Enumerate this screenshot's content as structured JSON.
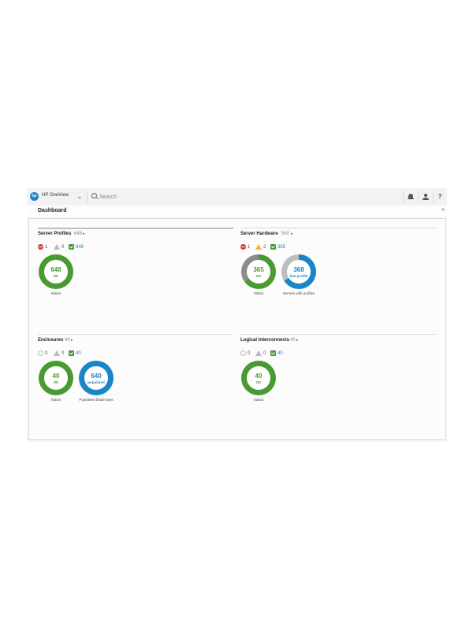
{
  "header": {
    "logo_text": "hp",
    "app_title": "HP OneView",
    "search_placeholder": "Search",
    "icons": [
      "chevron-down-icon",
      "search-icon",
      "bell-icon",
      "user-icon",
      "help-icon"
    ],
    "help_label": "?"
  },
  "dashboard": {
    "title": "Dashboard",
    "collapse_label": "«"
  },
  "colors": {
    "ok": "#4a9a32",
    "info": "#1a86c8",
    "critical": "#d9322d",
    "warning": "#f2b821",
    "disabled": "#8c8c8c"
  },
  "panels": {
    "server_profiles": {
      "title": "Server Profiles",
      "count": "649",
      "arrow": "▸",
      "critical": "1",
      "warning": "0",
      "ok": "648",
      "donut": {
        "value": "648",
        "label": "OK",
        "caption": "Status",
        "ok_fraction": 0.998
      }
    },
    "server_hardware": {
      "title": "Server Hardware",
      "count": "560",
      "arrow": "▸",
      "critical": "1",
      "warning": "2",
      "ok": "365",
      "donut_status": {
        "value": "365",
        "label": "OK",
        "caption": "Status",
        "ok_fraction": 0.65
      },
      "donut_profiles": {
        "value": "368",
        "label": "has profile",
        "caption": "Servers with profiles",
        "fraction": 0.66
      }
    },
    "enclosures": {
      "title": "Enclosures",
      "count": "40",
      "arrow": "▸",
      "critical": "0",
      "warning": "0",
      "ok": "40",
      "donut_status": {
        "value": "40",
        "label": "OK",
        "caption": "Status",
        "ok_fraction": 1.0
      },
      "donut_bays": {
        "value": "640",
        "label": "populated",
        "caption": "Populated blade bays",
        "fraction": 1.0
      }
    },
    "logical_interconnects": {
      "title": "Logical Interconnects",
      "count": "40",
      "arrow": "▸",
      "critical": "0",
      "warning": "0",
      "ok": "40",
      "donut": {
        "value": "40",
        "label": "OK",
        "caption": "Status",
        "ok_fraction": 1.0
      }
    }
  }
}
